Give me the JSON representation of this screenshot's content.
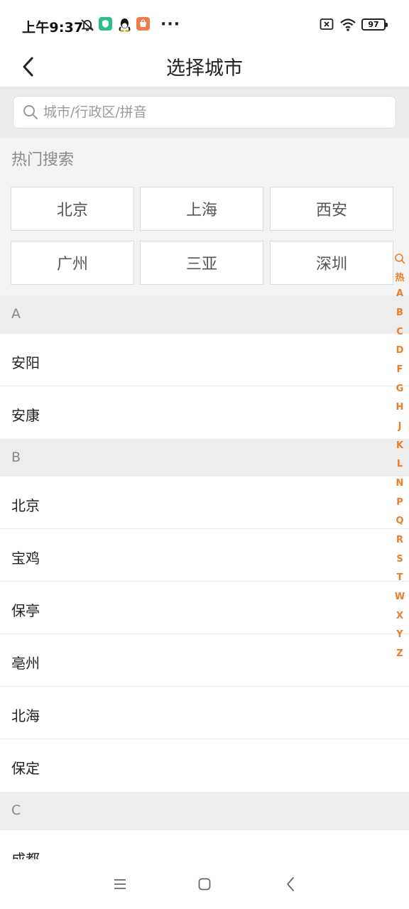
{
  "status": {
    "time": "上午9:37",
    "more": "···",
    "battery": "97"
  },
  "header": {
    "title": "选择城市"
  },
  "search": {
    "placeholder": "城市/行政区/拼音"
  },
  "hot": {
    "title": "热门搜索",
    "cities": [
      "北京",
      "上海",
      "西安",
      "广州",
      "三亚",
      "深圳"
    ]
  },
  "sections": [
    {
      "letter": "A",
      "cities": [
        "安阳",
        "安康"
      ]
    },
    {
      "letter": "B",
      "cities": [
        "北京",
        "宝鸡",
        "保亭",
        "亳州",
        "北海",
        "保定"
      ]
    },
    {
      "letter": "C",
      "cities": [
        "成都"
      ]
    }
  ],
  "index": [
    "热",
    "A",
    "B",
    "C",
    "D",
    "F",
    "G",
    "H",
    "J",
    "K",
    "L",
    "N",
    "P",
    "Q",
    "R",
    "S",
    "T",
    "W",
    "X",
    "Y",
    "Z"
  ],
  "colors": {
    "accent": "#f07c28",
    "section_bg": "#ededed"
  }
}
